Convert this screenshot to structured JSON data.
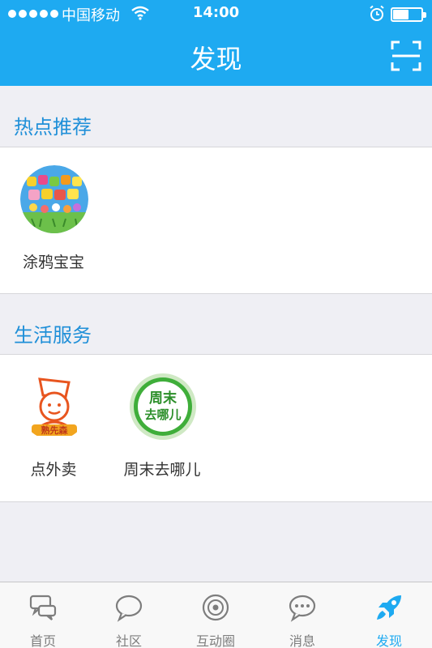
{
  "status_bar": {
    "carrier": "中国移动",
    "time": "14:00",
    "battery_level": 0.55
  },
  "nav": {
    "title": "发现",
    "scan_icon": "scan-icon"
  },
  "sections": [
    {
      "title": "热点推荐",
      "items": [
        {
          "label": "涂鸦宝宝",
          "icon": "graffiti-baby-icon"
        }
      ]
    },
    {
      "title": "生活服务",
      "items": [
        {
          "label": "点外卖",
          "icon": "takeout-chef-icon"
        },
        {
          "label": "周末去哪儿",
          "icon": "weekend-trip-icon",
          "icon_text_1": "周末",
          "icon_text_2": "去哪儿"
        }
      ]
    }
  ],
  "tabbar": {
    "tabs": [
      {
        "label": "首页",
        "icon": "home-chat-icon"
      },
      {
        "label": "社区",
        "icon": "speech-bubble-icon"
      },
      {
        "label": "互动圈",
        "icon": "interaction-circle-icon"
      },
      {
        "label": "消息",
        "icon": "message-dots-icon"
      },
      {
        "label": "发现",
        "icon": "rocket-icon",
        "active": true
      }
    ]
  },
  "colors": {
    "brand": "#1eaaf1",
    "section_title": "#1f8fd8",
    "background": "#efeff4"
  }
}
